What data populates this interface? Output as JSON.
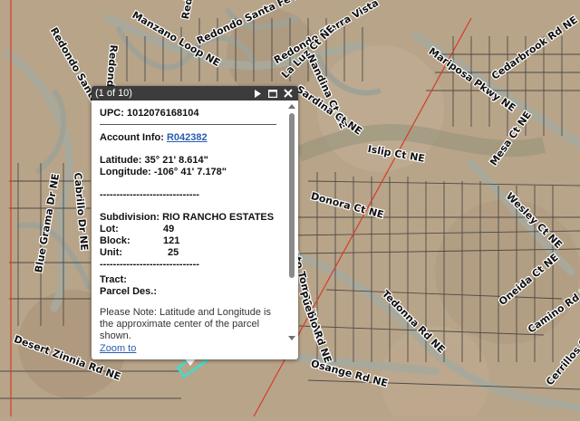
{
  "map": {
    "colors": {
      "terrain": "#b9a58c",
      "road": "#a9aa9c",
      "parcel_line": "#3b3b3b",
      "boundary": "#d63c2a",
      "highlight": "#39e0d0"
    },
    "street_labels": [
      "Redondo Santa Fe",
      "Redondo Sierra Vista",
      "Redondo Santa Fe NE",
      "Redondo Sierra Vista",
      "Redondo Cir NE",
      "La Luz Ct NE",
      "Nandina Ct NE",
      "Manzano Loop NE",
      "Sardina Ct NE",
      "Mariposa Pkwy NE",
      "Cedarbrook Rd NE",
      "Mesa Ct NE",
      "Islip Ct NE",
      "Donora Ct NE",
      "Wesley Ct NE",
      "Blue Grama Dr NE",
      "Desert Zinnia Rd NE",
      "Cabrillo Dr NE",
      "Santo Tomas Dr NE",
      "Pueblo Rd NE",
      "Tedonna Rd NE",
      "Oneida Ct NE",
      "Camino Rd NE",
      "Osange Rd NE",
      "Cerrillos Ct NE"
    ]
  },
  "popup": {
    "pager": "(1 of 10)",
    "upc_label": "UPC:",
    "upc_value": "1012076168104",
    "account_label": "Account Info:",
    "account_link": "R042382",
    "latitude_label": "Latitude:",
    "latitude_value": "35° 21' 8.614\"",
    "longitude_label": "Longitude:",
    "longitude_value": "-106° 41' 7.178\"",
    "divider": "------------------------------",
    "subdivision_label": "Subdivision:",
    "subdivision_value": "RIO RANCHO ESTATES",
    "lot_label": "Lot:",
    "lot_value": "49",
    "block_label": "Block:",
    "block_value": "121",
    "unit_label": "Unit:",
    "unit_value": "25",
    "tract_label": "Tract:",
    "parcel_label": "Parcel Des.:",
    "note": "Please Note: Latitude and Longitude is the approximate center of the parcel shown.",
    "zoom_link": "Zoom to"
  }
}
